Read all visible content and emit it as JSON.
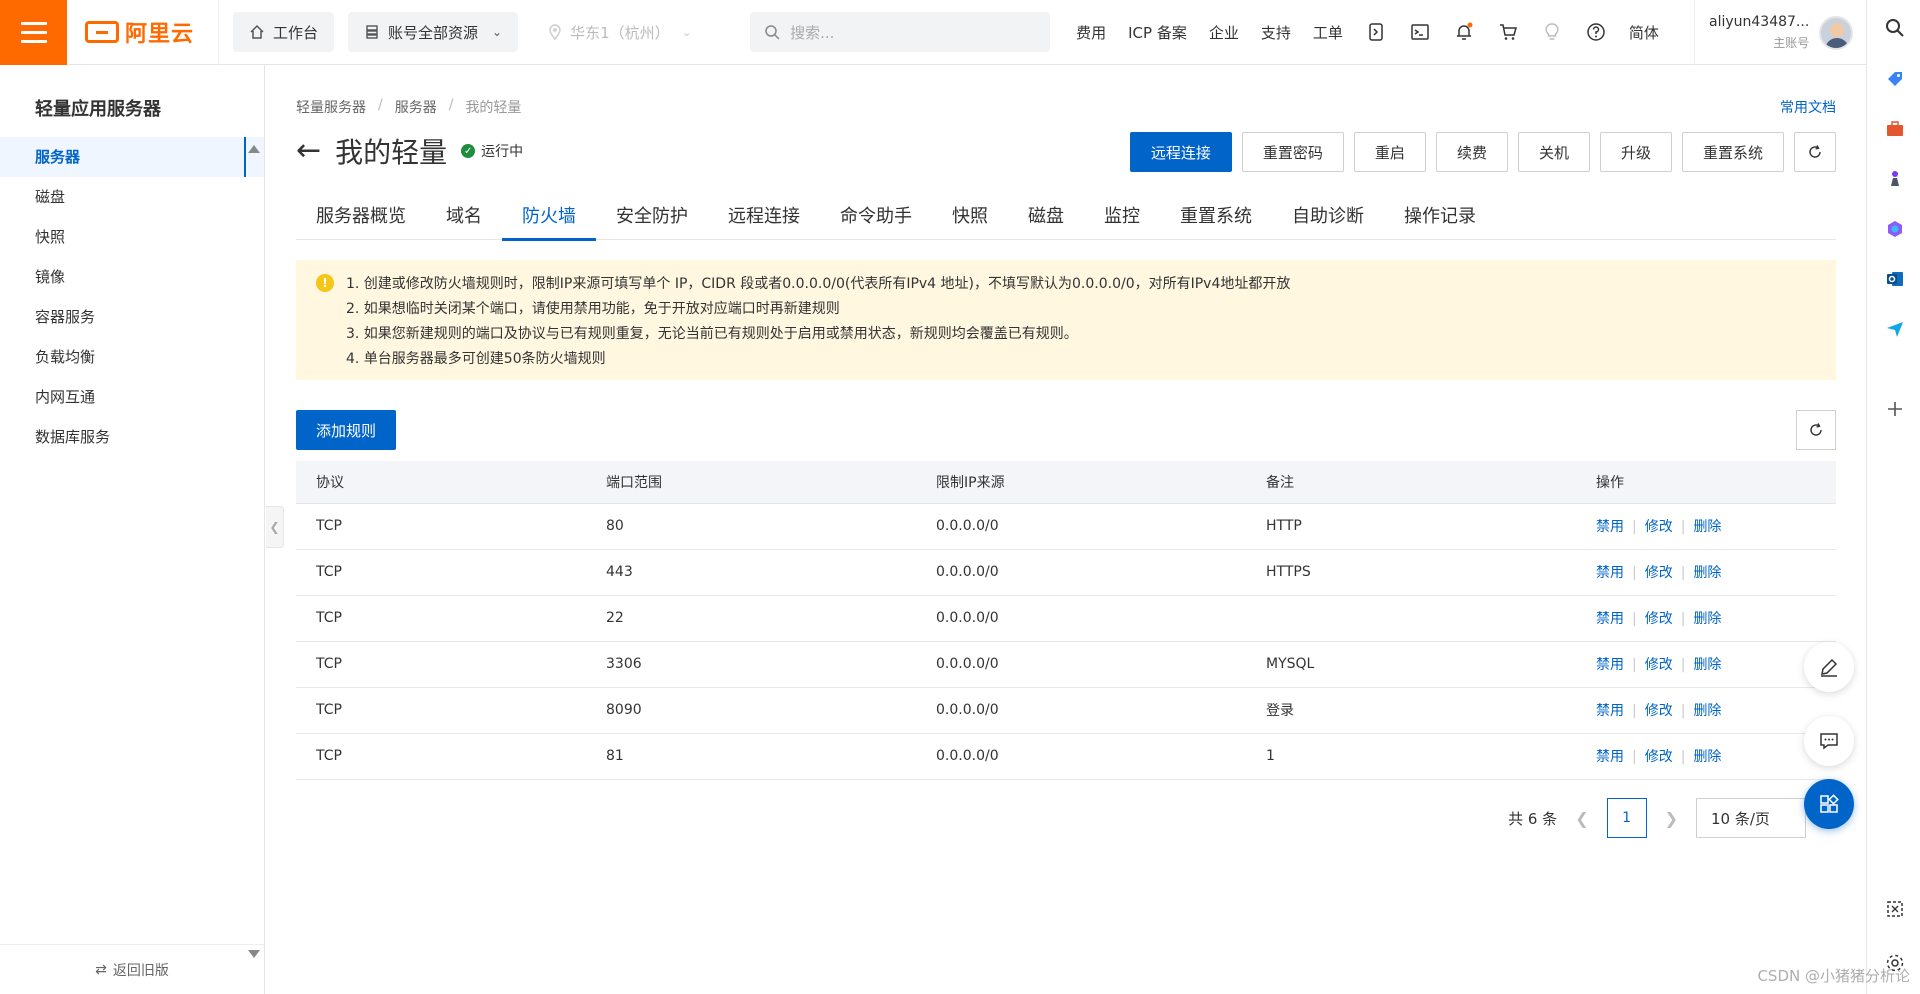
{
  "topbar": {
    "logo_text": "阿里云",
    "workbench": "工作台",
    "resources": "账号全部资源",
    "region": "华东1（杭州）",
    "search_placeholder": "搜索...",
    "links": [
      "费用",
      "ICP 备案",
      "企业",
      "支持",
      "工单"
    ],
    "lang": "简体",
    "user_name": "aliyun43487...",
    "user_role": "主账号"
  },
  "sidebar": {
    "title": "轻量应用服务器",
    "items": [
      {
        "label": "服务器",
        "active": true
      },
      {
        "label": "磁盘"
      },
      {
        "label": "快照"
      },
      {
        "label": "镜像"
      },
      {
        "label": "容器服务"
      },
      {
        "label": "负载均衡"
      },
      {
        "label": "内网互通"
      },
      {
        "label": "数据库服务"
      }
    ],
    "footer": "返回旧版"
  },
  "breadcrumb": [
    "轻量服务器",
    "服务器",
    "我的轻量"
  ],
  "doc_link": "常用文档",
  "page": {
    "title": "我的轻量",
    "status": "运行中"
  },
  "actions": [
    "远程连接",
    "重置密码",
    "重启",
    "续费",
    "关机",
    "升级",
    "重置系统"
  ],
  "tabs": [
    "服务器概览",
    "域名",
    "防火墙",
    "安全防护",
    "远程连接",
    "命令助手",
    "快照",
    "磁盘",
    "监控",
    "重置系统",
    "自助诊断",
    "操作记录"
  ],
  "active_tab": "防火墙",
  "notice": [
    "1. 创建或修改防火墙规则时，限制IP来源可填写单个 IP，CIDR 段或者0.0.0.0/0(代表所有IPv4 地址)，不填写默认为0.0.0.0/0，对所有IPv4地址都开放",
    "2. 如果想临时关闭某个端口，请使用禁用功能，免于开放对应端口时再新建规则",
    "3. 如果您新建规则的端口及协议与已有规则重复，无论当前已有规则处于启用或禁用状态，新规则均会覆盖已有规则。",
    "4. 单台服务器最多可创建50条防火墙规则"
  ],
  "add_rule": "添加规则",
  "table": {
    "headers": [
      "协议",
      "端口范围",
      "限制IP来源",
      "备注",
      "操作"
    ],
    "rows": [
      {
        "protocol": "TCP",
        "port": "80",
        "source": "0.0.0.0/0",
        "note": "HTTP"
      },
      {
        "protocol": "TCP",
        "port": "443",
        "source": "0.0.0.0/0",
        "note": "HTTPS"
      },
      {
        "protocol": "TCP",
        "port": "22",
        "source": "0.0.0.0/0",
        "note": ""
      },
      {
        "protocol": "TCP",
        "port": "3306",
        "source": "0.0.0.0/0",
        "note": "MYSQL"
      },
      {
        "protocol": "TCP",
        "port": "8090",
        "source": "0.0.0.0/0",
        "note": "登录"
      },
      {
        "protocol": "TCP",
        "port": "81",
        "source": "0.0.0.0/0",
        "note": "1"
      }
    ],
    "ops": [
      "禁用",
      "修改",
      "删除"
    ]
  },
  "pager": {
    "total": "共 6 条",
    "current_page": "1",
    "page_size": "10 条/页"
  },
  "watermark": "CSDN @小猪猪分析论",
  "colors": {
    "brand_orange": "#ff6a00",
    "primary_blue": "#0064c8",
    "notice_bg": "#fff7e0",
    "status_green": "#1e8e3e"
  },
  "rail_icons": [
    "search-icon",
    "tag-icon",
    "toolbox-icon",
    "chess-icon",
    "copilot-icon",
    "outlook-icon",
    "send-icon",
    "plus-icon",
    "screenshot-icon",
    "settings-icon"
  ]
}
